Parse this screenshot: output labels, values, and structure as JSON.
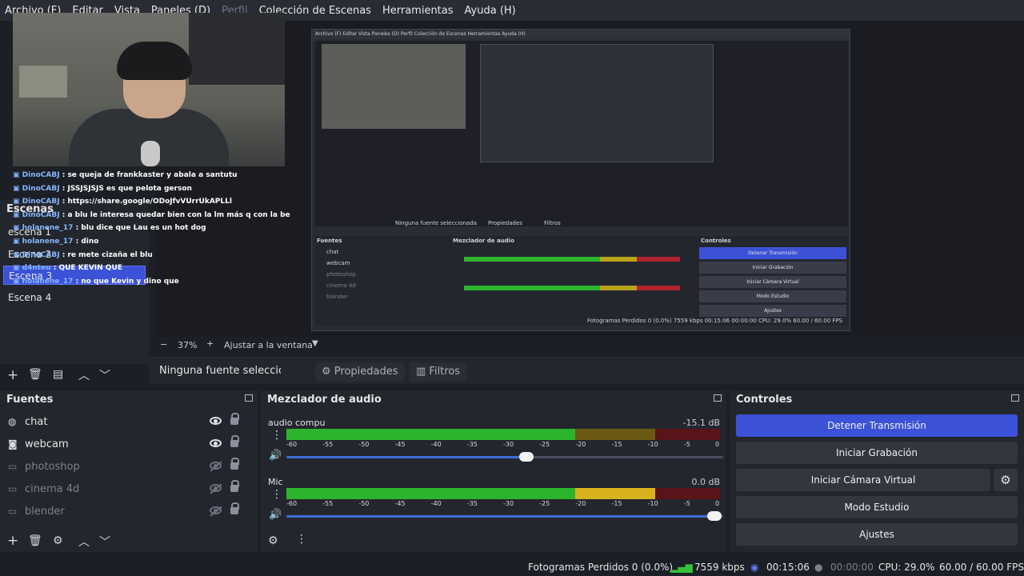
{
  "menu": {
    "items": [
      {
        "label": "Archivo (F)",
        "disabled": false
      },
      {
        "label": "Editar",
        "disabled": false
      },
      {
        "label": "Vista",
        "disabled": false
      },
      {
        "label": "Paneles (D)",
        "disabled": false
      },
      {
        "label": "Perfil",
        "disabled": true
      },
      {
        "label": "Colección de Escenas",
        "disabled": false
      },
      {
        "label": "Herramientas",
        "disabled": false
      },
      {
        "label": "Ayuda (H)",
        "disabled": false
      }
    ]
  },
  "chat": [
    {
      "user": "DinoCABJ",
      "msg": "se queja de frankkaster y abala a santutu"
    },
    {
      "user": "DinoCABJ",
      "msg": "JSSJSJSJS es que pelota gerson"
    },
    {
      "user": "DinoCABJ",
      "msg": "https://share.google/ODoJfvVUrrUkAPLLl"
    },
    {
      "user": "DinoCABJ",
      "msg": "a blu le interesa quedar bien con la lm más q con la be"
    },
    {
      "user": "holanene_17",
      "msg": "blu dice que Lau es un hot dog"
    },
    {
      "user": "holanene_17",
      "msg": "dino"
    },
    {
      "user": "DinoCABJ",
      "msg": "re mete cizaña el blu"
    },
    {
      "user": "d4nteu",
      "msg": "QUE KEVIN QUE"
    },
    {
      "user": "holanene_17",
      "msg": "no que Kevin y dino que"
    }
  ],
  "scenes": {
    "title": "Escenas",
    "items": [
      {
        "label": "escena 1",
        "active": false
      },
      {
        "label": "Escena 2",
        "active": false
      },
      {
        "label": "Escena 3",
        "active": true
      },
      {
        "label": "Escena 4",
        "active": false
      }
    ]
  },
  "preview": {
    "mini_menu": "Archivo (F)  Editar  Vista  Paneles (D)  Perfil  Colección de Escenas  Herramientas  Ayuda (H)",
    "mini_context": "Ninguna fuente seleccionada",
    "mini_props": "Propiedades",
    "mini_filters": "Filtros",
    "mini_sources_title": "Fuentes",
    "mini_mixer_title": "Mezclador de audio",
    "mini_controls_title": "Controles",
    "mini_controls": [
      "Detener Transmisión",
      "Iniciar Grabación",
      "Iniciar Cámara Virtual",
      "Modo Estudio",
      "Ajustes"
    ],
    "mini_sources": [
      "chat",
      "webcam",
      "photoshop",
      "cinema 4d",
      "blender"
    ],
    "mini_status": "Fotogramas Perdidos 0 (0.0%)   7559 kbps   00:15:06   00:00:00   CPU: 29.0%   60.00 / 60.00 FPS",
    "mini_zoom": "37%   Ajustar a la ventana"
  },
  "zoom": {
    "value": "37%",
    "fit_label": "Ajustar a la ventana"
  },
  "context": {
    "no_source": "Ninguna fuente seleccionada",
    "properties": "Propiedades",
    "filters": "Filtros"
  },
  "sources": {
    "title": "Fuentes",
    "items": [
      {
        "name": "chat",
        "icon": "globe-icon",
        "visible": true
      },
      {
        "name": "webcam",
        "icon": "camera-icon",
        "visible": true
      },
      {
        "name": "photoshop",
        "icon": "window-icon",
        "visible": false
      },
      {
        "name": "cinema 4d",
        "icon": "window-icon",
        "visible": false
      },
      {
        "name": "blender",
        "icon": "window-icon",
        "visible": false
      }
    ]
  },
  "mixer": {
    "title": "Mezclador de audio",
    "ticks": [
      "-60",
      "-55",
      "-50",
      "-45",
      "-40",
      "-35",
      "-30",
      "-25",
      "-20",
      "-15",
      "-10",
      "-5",
      "0"
    ],
    "channels": [
      {
        "name": "audio compu",
        "db": "-15.1 dB",
        "level_db": -20,
        "volume_fraction": 0.55
      },
      {
        "name": "Mic",
        "db": "0.0 dB",
        "level_db": -5,
        "volume_fraction": 0.98
      }
    ],
    "colors": {
      "green": "#2db42d",
      "yellow": "#d8b21f",
      "red": "#b02430",
      "green_dim": "#1a5a1f",
      "yellow_dim": "#6a5a14",
      "red_dim": "#5a1419"
    }
  },
  "controls": {
    "title": "Controles",
    "stop_stream": "Detener Transmisión",
    "start_recording": "Iniciar Grabación",
    "start_virtual_cam": "Iniciar Cámara Virtual",
    "studio_mode": "Modo Estudio",
    "settings": "Ajustes"
  },
  "status": {
    "dropped": "Fotogramas Perdidos 0 (0.0%)",
    "bitrate": "7559 kbps",
    "stream_time": "00:15:06",
    "rec_time": "00:00:00",
    "cpu": "CPU: 29.0%",
    "fps": "60.00 / 60.00 FPS"
  },
  "colors": {
    "accent": "#3b52d6",
    "background": "#1d1f26",
    "panel": "#24262e"
  }
}
